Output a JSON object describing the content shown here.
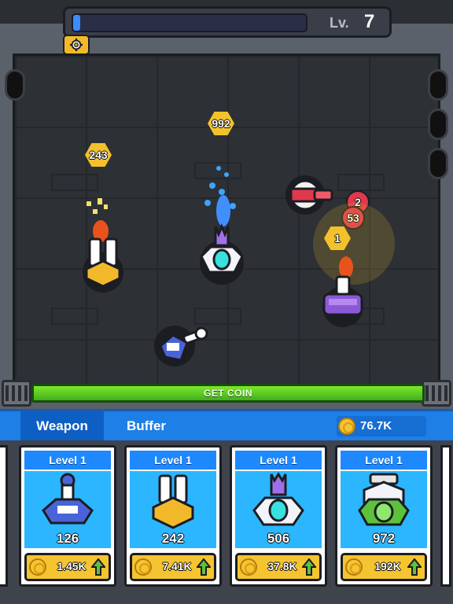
{
  "hud": {
    "level_label": "Lv.",
    "level_value": "7",
    "xp_progress": 0.03
  },
  "arena": {
    "enemies": [
      {
        "value": "992",
        "shape": "hexagon",
        "color": "#f3c12b"
      },
      {
        "value": "243",
        "shape": "hexagon",
        "color": "#f3c12b"
      },
      {
        "value": "2",
        "shape": "circle",
        "color": "#e0384d"
      },
      {
        "value": "53",
        "shape": "circle",
        "color": "#e0384d"
      },
      {
        "value": "1",
        "shape": "hexagon",
        "color": "#f3c12b"
      }
    ],
    "coin_bar_label": "GET COIN"
  },
  "shop": {
    "tabs": [
      {
        "label": "Weapon",
        "active": true
      },
      {
        "label": "Buffer",
        "active": false
      }
    ],
    "coin_total": "76.7K",
    "cards": [
      {
        "level": "Level 1",
        "damage": "126",
        "price": "1.45K",
        "turret": "blue-turret-icon",
        "color": "#4a63d8"
      },
      {
        "level": "Level 1",
        "damage": "242",
        "price": "7.41K",
        "turret": "yellow-twin-turret-icon",
        "color": "#f1b92a"
      },
      {
        "level": "Level 1",
        "damage": "506",
        "price": "37.8K",
        "turret": "purple-turret-icon",
        "color": "#8a5ad6"
      },
      {
        "level": "Level 1",
        "damage": "972",
        "price": "192K",
        "turret": "green-turret-icon",
        "color": "#5cc23c"
      }
    ]
  },
  "colors": {
    "accent": "#1e88ff",
    "coin": "#f5c431",
    "bar": "#7ee82e"
  }
}
